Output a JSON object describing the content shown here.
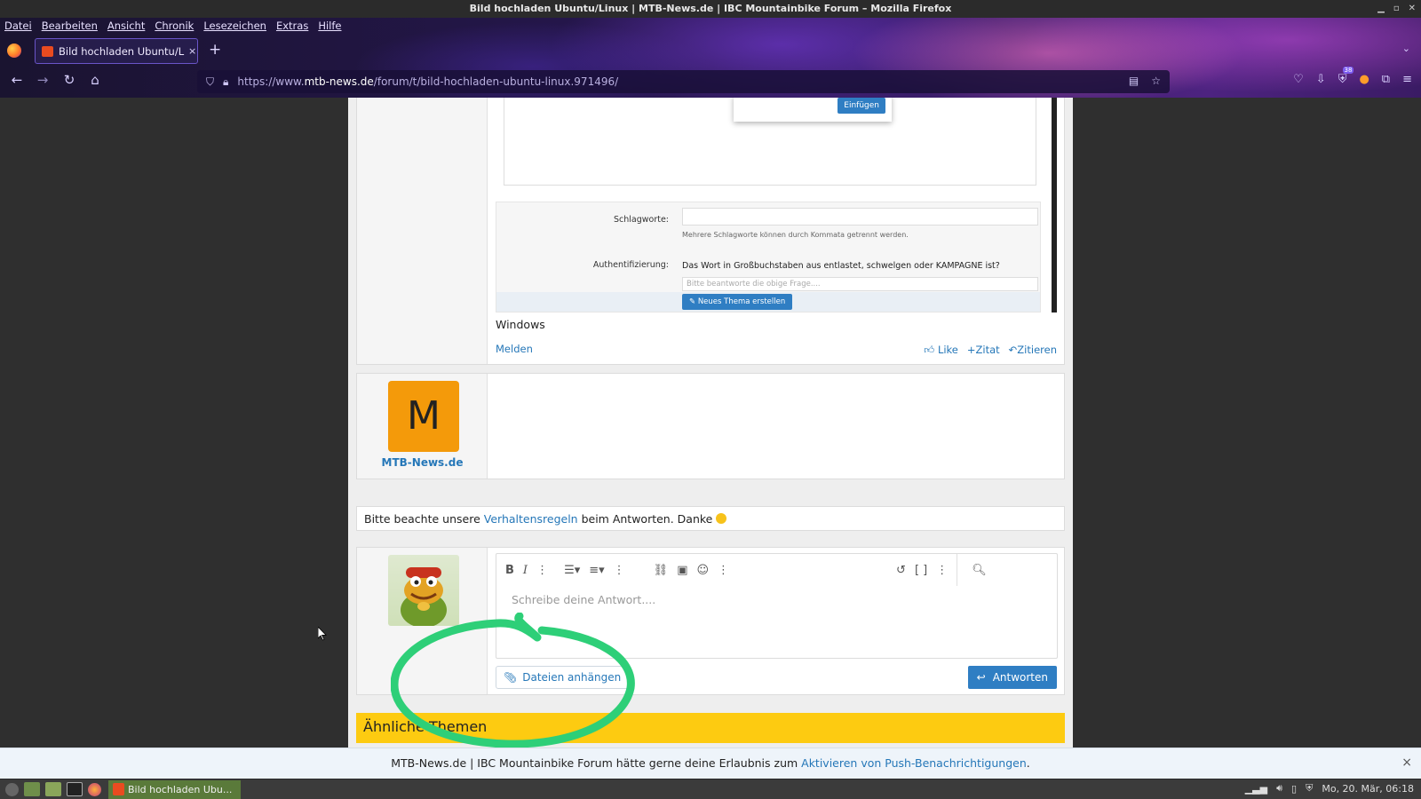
{
  "window": {
    "title": "Bild hochladen Ubuntu/Linux | MTB-News.de | IBC Mountainbike Forum – Mozilla Firefox"
  },
  "menubar": [
    "Datei",
    "Bearbeiten",
    "Ansicht",
    "Chronik",
    "Lesezeichen",
    "Extras",
    "Hilfe"
  ],
  "tab": {
    "title": "Bild hochladen Ubuntu/Linux",
    "close": "×",
    "new_tab": "+"
  },
  "url": {
    "prefix": "https://www.",
    "domain": "mtb-news.de",
    "path": "/forum/t/bild-hochladen-ubuntu-linux.971496/"
  },
  "extensions": {
    "badge_count": "38"
  },
  "embedded_screenshot": {
    "popup_button": "Einfügen",
    "schlagworte_label": "Schlagworte:",
    "schlagworte_hint": "Mehrere Schlagworte können durch Kommata getrennt werden.",
    "auth_label": "Authentifizierung:",
    "auth_question": "Das Wort in Großbuchstaben aus entlastet, schwelgen oder KAMPAGNE ist?",
    "auth_placeholder": "Bitte beantworte die obige Frage....",
    "submit": "Neues Thema erstellen"
  },
  "post": {
    "text": "Windows",
    "report": "Melden",
    "like": "Like",
    "zitat": "Zitat",
    "zitieren": "Zitieren"
  },
  "post2": {
    "avatar_letter": "M",
    "author": "MTB-News.de"
  },
  "notice": {
    "before": "Bitte beachte unsere ",
    "link": "Verhaltensregeln",
    "after": " beim Antworten. Danke "
  },
  "reply": {
    "placeholder": "Schreibe deine Antwort....",
    "attach": "Dateien anhängen",
    "submit": "Antworten"
  },
  "similar": {
    "title": "Ähnliche Themen"
  },
  "push": {
    "text": "MTB-News.de | IBC Mountainbike Forum hätte gerne deine Erlaubnis zum ",
    "link": "Aktivieren von Push-Benachrichtigungen",
    "end": ".",
    "close": "×"
  },
  "taskbar": {
    "task": "Bild hochladen Ubu...",
    "clock": "Mo, 20. Mär, 06:18"
  },
  "colors": {
    "link": "#2577b8",
    "button": "#2f7ec3",
    "avatar": "#f49a0a",
    "similar_bar": "#fdcb11",
    "annotation_ring": "#2ecf78"
  }
}
